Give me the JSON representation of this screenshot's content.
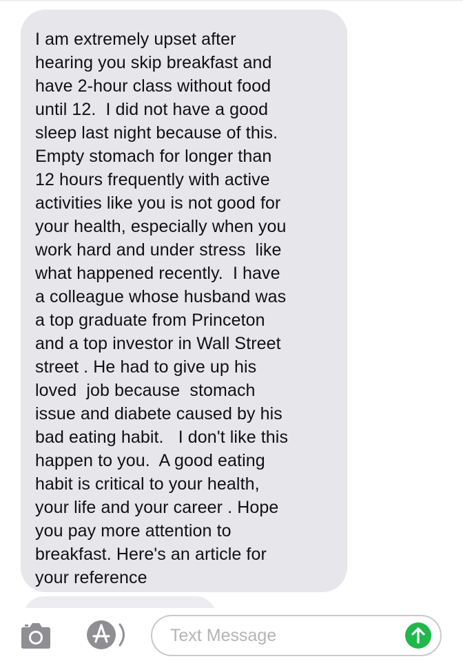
{
  "conversation": {
    "received_message": {
      "lines": [
        "I am extremely upset after",
        "hearing you skip breakfast and",
        "have 2-hour class without food",
        "until 12.  I did not have a good",
        "sleep last night because of this.",
        "Empty stomach for longer than",
        "12 hours frequently with active",
        "activities like you is not good for",
        "your health, especially when you",
        "work hard and under stress  like",
        "what happened recently.  I have",
        "a colleague whose husband was",
        "a top graduate from Princeton",
        "and a top investor in Wall Street",
        "street . He had to give up his",
        "loved  job because  stomach",
        "issue and diabete caused by his",
        "bad eating habit.   I don't like this",
        "happen to you.  A good eating",
        "habit is critical to your health,",
        "your life and your career . Hope",
        "you pay more attention to",
        "breakfast. Here's an article for",
        "your reference"
      ]
    }
  },
  "composer": {
    "placeholder": "Text Message",
    "icons": {
      "camera": "camera-icon",
      "apps": "app-store-icon",
      "send": "send-arrow-icon"
    }
  },
  "colors": {
    "received_bubble": "#e6e6eb",
    "send_button": "#1fb84a",
    "icon_gray": "#8e8e93"
  }
}
